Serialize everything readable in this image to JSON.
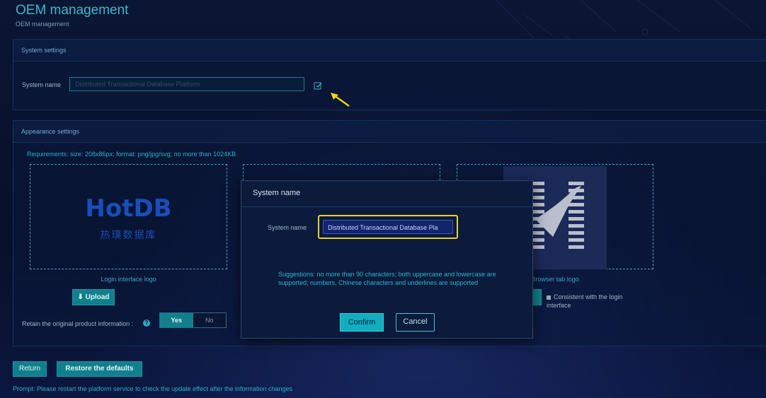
{
  "header": {
    "title": "OEM management",
    "breadcrumb": "OEM management"
  },
  "system_settings": {
    "title": "System settings",
    "name_label": "System name",
    "name_value": "Distributed Transactional Database Platform",
    "edit_icon": "edit-icon"
  },
  "appearance": {
    "title": "Appearance settings",
    "requirements": "Requirements: size: 208x86px; format: png/jpg/svg; no more than 1024KB",
    "login_logo": {
      "brand": "HotDB",
      "subtitle": "热璞数据库",
      "caption": "Login interface logo"
    },
    "browser_tab_logo": {
      "caption": "Browser tab logo",
      "consistent_label": "Consistent with the login interface"
    },
    "upload_label": "Upload",
    "retain_label": "Retain the original product information :",
    "retain_options": [
      "Yes",
      "No"
    ],
    "retain_selected": "Yes"
  },
  "actions": {
    "return_label": "Return",
    "restore_label": "Restore the defaults"
  },
  "prompt": "Prompt: Please restart the platform service to check the update effect after the information changes",
  "modal": {
    "title": "System name",
    "field_label": "System name",
    "field_value": "Distributed Transactional Database Pla",
    "suggestion": "Suggestions: no more than 90 characters; both uppercase and lowercase are supported; numbers, Chinese characters and underlines are supported",
    "confirm_label": "Confirm",
    "cancel_label": "Cancel"
  },
  "colors": {
    "accent": "#11808c",
    "highlight": "#e8d22a",
    "background": "#08122e"
  }
}
